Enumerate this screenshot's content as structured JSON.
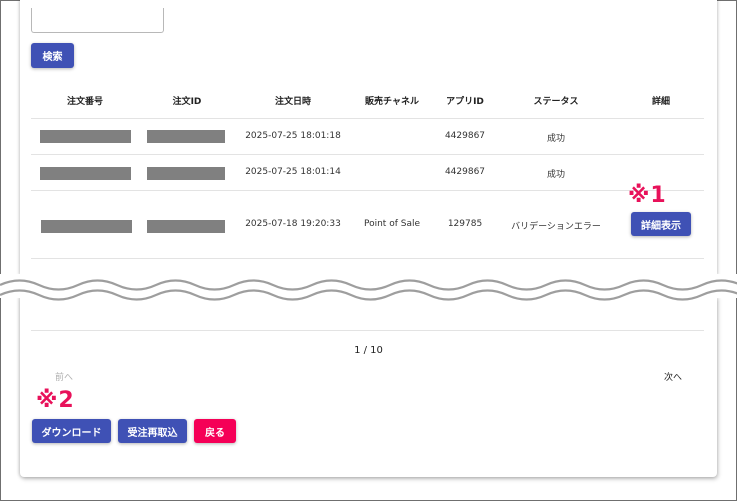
{
  "search": {
    "input_value": "",
    "button_label": "検索"
  },
  "table": {
    "columns": [
      "注文番号",
      "注文ID",
      "注文日時",
      "販売チャネル",
      "アプリID",
      "ステータス",
      "詳細"
    ],
    "rows": [
      {
        "order_number": "",
        "order_id": "",
        "datetime": "2025-07-25 18:01:18",
        "channel": "",
        "app_id": "4429867",
        "status": "成功",
        "detail": ""
      },
      {
        "order_number": "",
        "order_id": "",
        "datetime": "2025-07-25 18:01:14",
        "channel": "",
        "app_id": "4429867",
        "status": "成功",
        "detail": ""
      },
      {
        "order_number": "",
        "order_id": "",
        "datetime": "2025-07-18 19:20:33",
        "channel": "Point of Sale",
        "app_id": "129785",
        "status": "バリデーションエラー",
        "detail": "詳細表示"
      }
    ]
  },
  "annotations": {
    "marker_1": "※1",
    "marker_2": "※2"
  },
  "pagination": {
    "page_label": "1 / 10",
    "prev_label": "前へ",
    "next_label": "次へ"
  },
  "actions": {
    "download_label": "ダウンロード",
    "reimport_label": "受注再取込",
    "back_label": "戻る"
  },
  "colors": {
    "primary": "#3f51b5",
    "danger": "#f50057",
    "marker": "#e8115a",
    "redaction": "#808080"
  }
}
